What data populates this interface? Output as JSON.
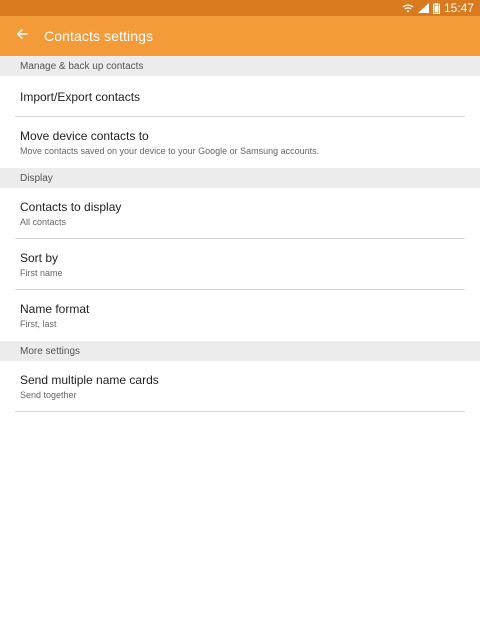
{
  "status": {
    "time": "15:47",
    "icons": [
      "wifi-icon",
      "signal-icon",
      "battery-icon"
    ]
  },
  "header": {
    "back_icon": "arrow-left-icon",
    "title": "Contacts settings"
  },
  "colors": {
    "status_bar": "#d97a1f",
    "app_bar": "#f39a39",
    "section_bg": "#ececec"
  },
  "sections": [
    {
      "header": "Manage & back up contacts",
      "items": [
        {
          "title": "Import/Export contacts",
          "subtitle": ""
        },
        {
          "title": "Move device contacts to",
          "subtitle": "Move contacts saved on your device to your Google or Samsung accounts."
        }
      ]
    },
    {
      "header": "Display",
      "items": [
        {
          "title": "Contacts to display",
          "subtitle": "All contacts"
        },
        {
          "title": "Sort by",
          "subtitle": "First name"
        },
        {
          "title": "Name format",
          "subtitle": "First, last"
        }
      ]
    },
    {
      "header": "More settings",
      "items": [
        {
          "title": "Send multiple name cards",
          "subtitle": "Send together"
        }
      ]
    }
  ]
}
